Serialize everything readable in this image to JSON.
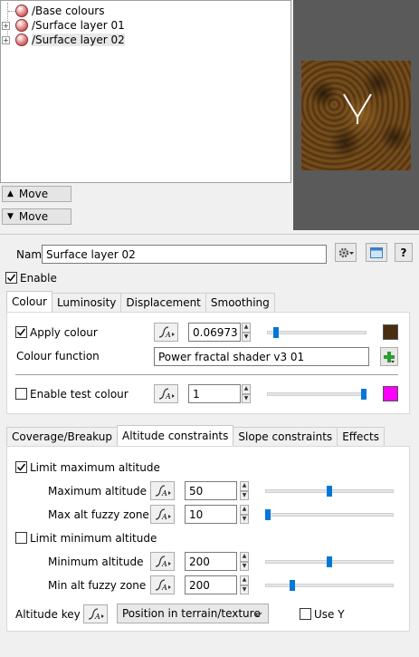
{
  "layer_tree": {
    "items": [
      {
        "label": "/Base colours"
      },
      {
        "label": "/Surface layer 01"
      },
      {
        "label": "/Surface layer 02"
      }
    ],
    "expander_symbol": "+"
  },
  "move_buttons": {
    "up_label": "Move",
    "down_label": "Move",
    "up_arrow": "▲",
    "down_arrow": "▼"
  },
  "name_row": {
    "label": "Name",
    "value": "Surface layer 02",
    "help_label": "?"
  },
  "enable": {
    "label": "Enable",
    "checked": true
  },
  "top_tabs": [
    {
      "label": "Colour"
    },
    {
      "label": "Luminosity"
    },
    {
      "label": "Displacement"
    },
    {
      "label": "Smoothing"
    }
  ],
  "colour_panel": {
    "apply_colour": {
      "label": "Apply colour",
      "checked": true,
      "value": "0.06973",
      "slider_fraction": 0.07,
      "swatch_color": "#4a2d10"
    },
    "colour_function": {
      "label": "Colour function",
      "value": "Power fractal shader v3 01"
    },
    "enable_test_colour": {
      "label": "Enable test colour",
      "checked": false,
      "value": "1",
      "slider_fraction": 1.0,
      "swatch_color": "#ff00ff"
    }
  },
  "bottom_tabs": [
    {
      "label": "Coverage/Breakup"
    },
    {
      "label": "Altitude constraints"
    },
    {
      "label": "Slope constraints"
    },
    {
      "label": "Effects"
    }
  ],
  "altitude_panel": {
    "limit_max": {
      "label": "Limit maximum altitude",
      "checked": true
    },
    "max_altitude": {
      "label": "Maximum altitude",
      "value": "50",
      "slider_fraction": 0.5
    },
    "max_fuzzy": {
      "label": "Max alt fuzzy zone",
      "value": "10",
      "slider_fraction": 0.0
    },
    "limit_min": {
      "label": "Limit minimum altitude",
      "checked": false
    },
    "min_altitude": {
      "label": "Minimum altitude",
      "value": "200",
      "slider_fraction": 0.5
    },
    "min_fuzzy": {
      "label": "Min alt fuzzy zone",
      "value": "200",
      "slider_fraction": 0.2
    },
    "altitude_key": {
      "label": "Altitude key",
      "value": "Position in terrain/texture"
    },
    "use_y": {
      "label": "Use Y",
      "checked": false
    }
  },
  "colors": {
    "accent": "#0078d7",
    "plus_green": "#2e9b2e"
  }
}
